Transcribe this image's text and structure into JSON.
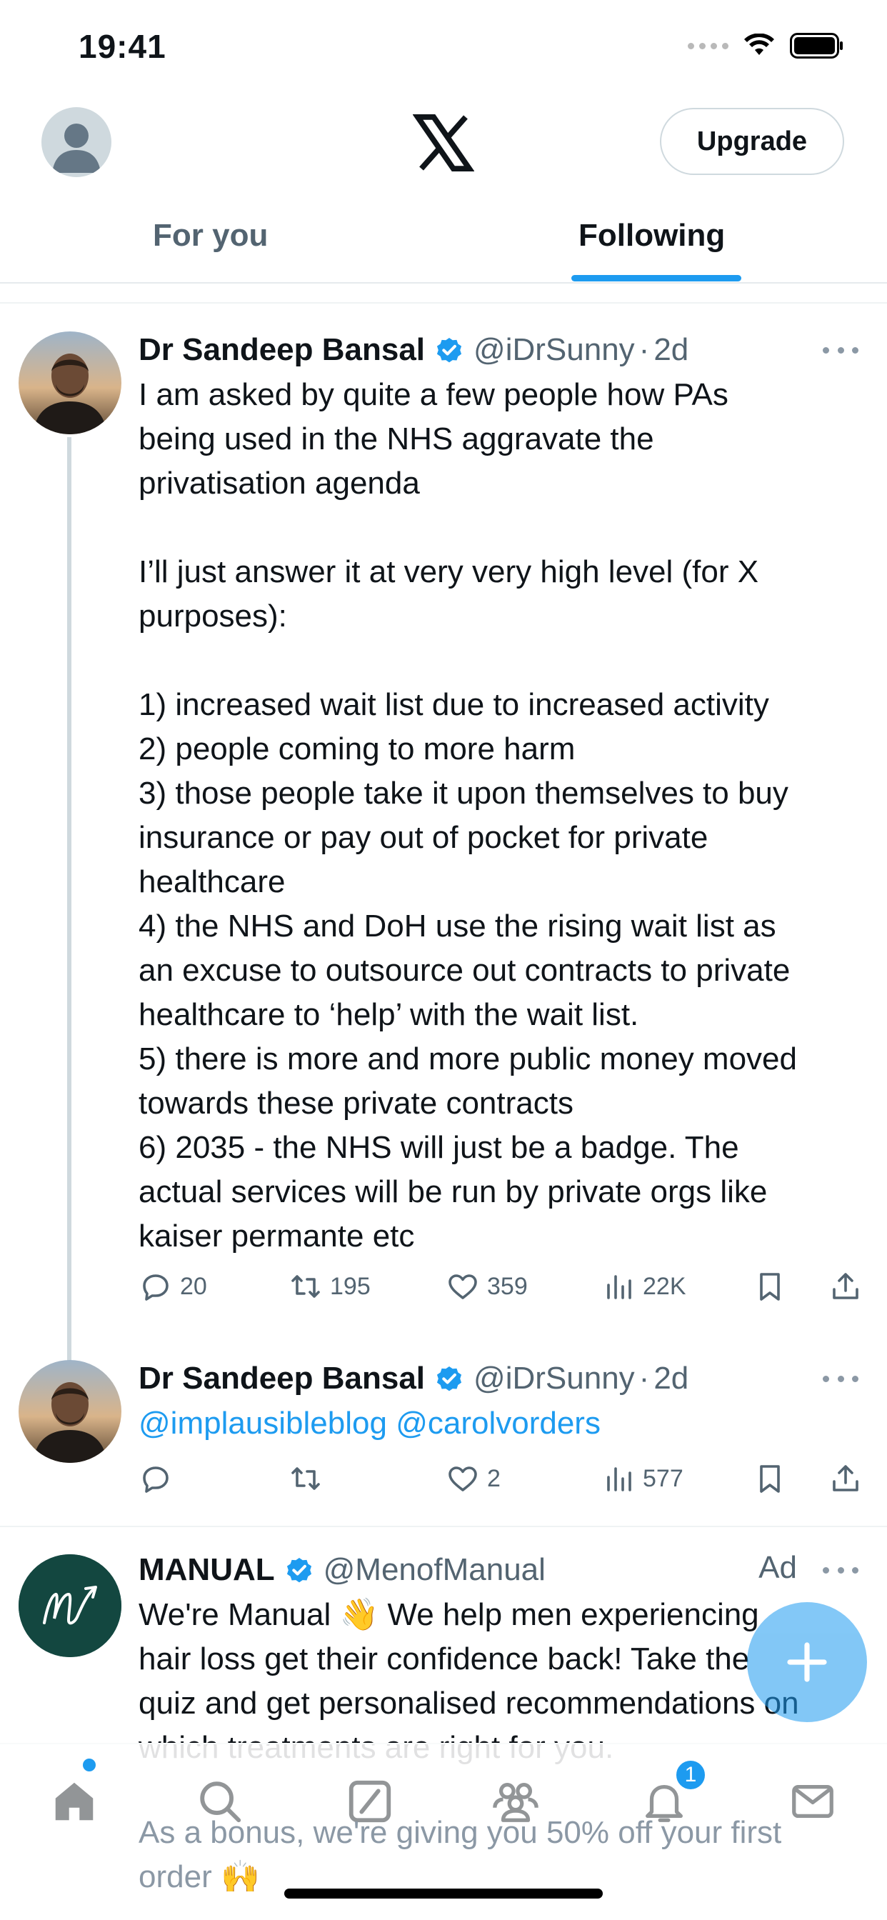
{
  "status_bar": {
    "time": "19:41"
  },
  "header": {
    "upgrade_label": "Upgrade"
  },
  "tabs": [
    {
      "label": "For you",
      "active": false
    },
    {
      "label": "Following",
      "active": true
    }
  ],
  "tweets": [
    {
      "name": "Dr Sandeep Bansal",
      "handle": "@iDrSunny",
      "sep": "·",
      "time": "2d",
      "text_lines": [
        "I am asked by quite a few people how PAs",
        "being used in the NHS aggravate the",
        "privatisation agenda",
        "",
        "I’ll just answer it at very very high level (for X",
        "purposes):",
        "",
        "1) increased wait list due to increased activity",
        "2) people coming to more harm",
        "3) those people take it upon themselves to buy",
        "insurance or pay out of pocket for private",
        "healthcare",
        "4) the NHS and DoH use the rising wait list as",
        "an excuse to outsource out contracts to private",
        "healthcare to ‘help’ with the wait list.",
        "5) there is more and more public money moved",
        "towards these private contracts",
        "6) 2035 - the NHS will just be a badge. The",
        "actual services will be run by private orgs like",
        "kaiser permante etc"
      ],
      "replies": "20",
      "reposts": "195",
      "likes": "359",
      "views": "22K"
    },
    {
      "name": "Dr Sandeep Bansal",
      "handle": "@iDrSunny",
      "sep": "·",
      "time": "2d",
      "mention_1": "@implausibleblog",
      "mention_2": "@carolvorders",
      "replies": "",
      "reposts": "",
      "likes": "2",
      "views": "577"
    },
    {
      "name": "MANUAL",
      "handle": "@MenofManual",
      "ad_label": "Ad",
      "text_lines": [
        "We're Manual 👋 We help men experiencing",
        "hair loss get their confidence back! Take the",
        "quiz and get personalised recommendations on",
        "which treatments are right for you."
      ],
      "faded_lines": [
        "As a bonus, we're giving you 50% off your first",
        "order 🙌"
      ]
    }
  ],
  "bottom_nav": {
    "items": [
      "home-icon",
      "search-icon",
      "grok-icon",
      "communities-icon",
      "notifications-icon",
      "messages-icon"
    ],
    "notification_count": "1"
  },
  "colors": {
    "accent": "#1d9bf0",
    "text": "#0f1419",
    "secondary": "#536471"
  }
}
